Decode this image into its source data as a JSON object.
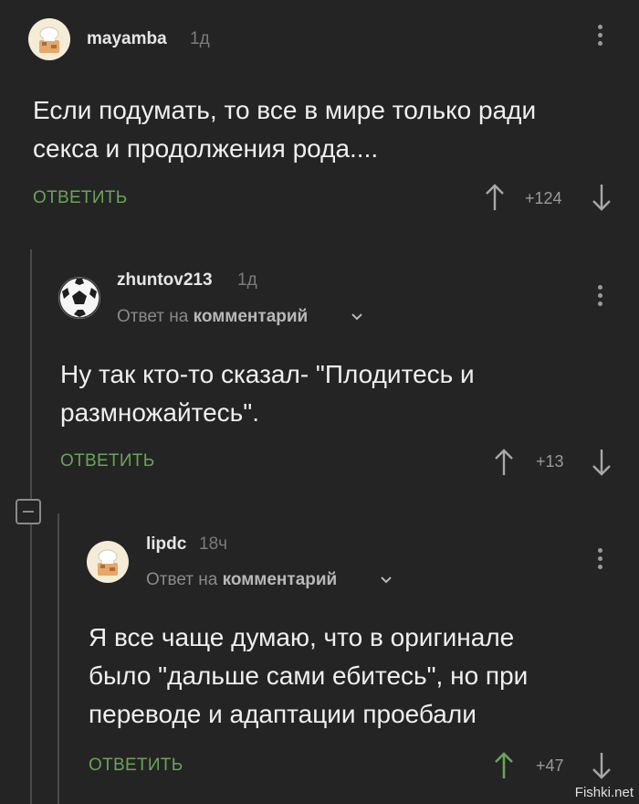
{
  "comments": [
    {
      "username": "mayamba",
      "time": "1д",
      "text_lines": [
        "Если подумать, то все в мире только ради",
        "секса и продолжения рода...."
      ],
      "reply_label": "ОТВЕТИТЬ",
      "score": "+124",
      "avatar": "chef-hat-avatar"
    },
    {
      "username": "zhuntov213",
      "time": "1д",
      "reply_to_prefix": "Ответ на",
      "reply_to_target": "комментарий",
      "text_lines": [
        "Ну так кто-то сказал- \"Плодитесь и",
        "размножайтесь\"."
      ],
      "reply_label": "ОТВЕТИТЬ",
      "score": "+13",
      "avatar": "soccer-ball-avatar"
    },
    {
      "username": "lipdc",
      "time": "18ч",
      "reply_to_prefix": "Ответ на",
      "reply_to_target": "комментарий",
      "text_lines": [
        "Я все чаще думаю, что в оригинале",
        "было \"дальше сами ебитесь\", но при",
        "переводе и адаптации проебали"
      ],
      "reply_label": "ОТВЕТИТЬ",
      "score": "+47",
      "avatar": "chef-hat-avatar"
    }
  ],
  "watermark": "Fishki.net",
  "colors": {
    "background": "#242424",
    "reply_green": "#6aa35a",
    "upvoted_green": "#6aa35a",
    "muted": "#9a9a9a"
  }
}
